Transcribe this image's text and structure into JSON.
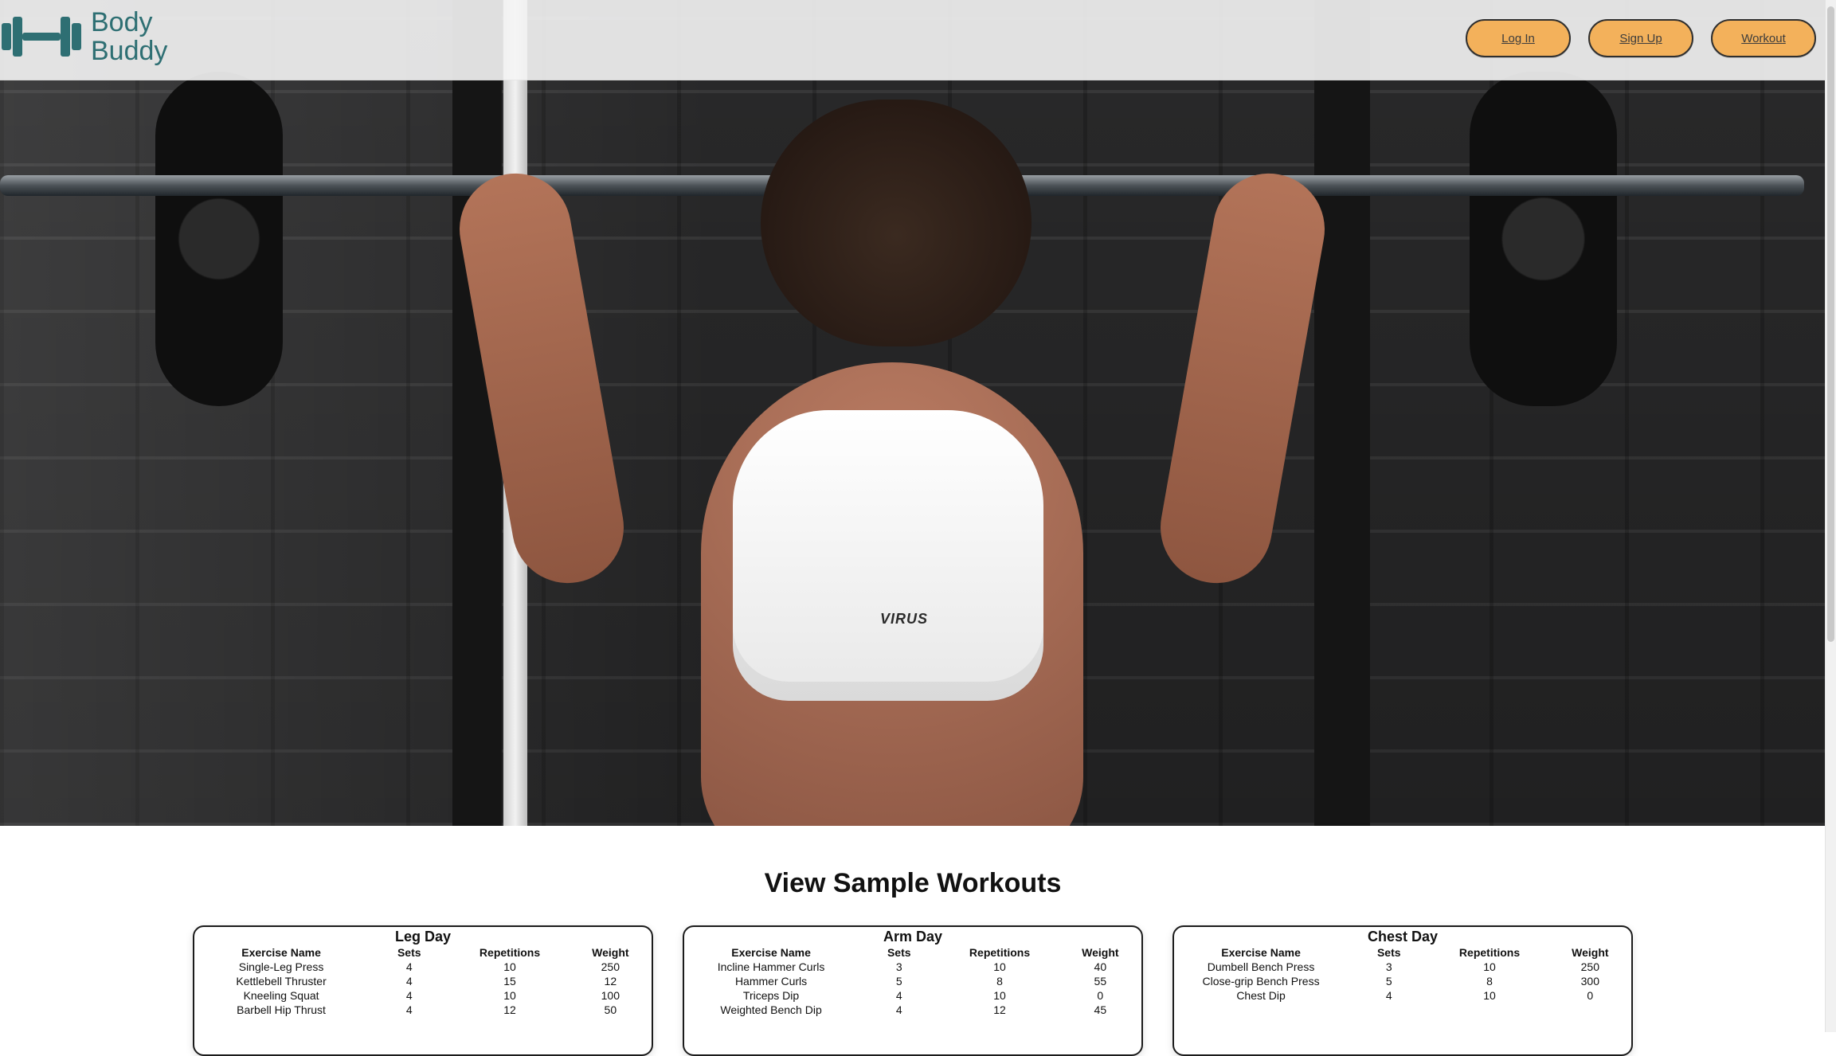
{
  "header": {
    "brand_line1": "Body",
    "brand_line2": "Buddy",
    "nav": {
      "login": "Log In",
      "signup": "Sign Up",
      "workout": "Workout"
    }
  },
  "hero": {
    "shirt_brand": "VIRUS"
  },
  "sample_workouts": {
    "title": "View Sample Workouts",
    "columns": [
      "Exercise Name",
      "Sets",
      "Repetitions",
      "Weight"
    ],
    "cards": [
      {
        "title": "Leg Day",
        "rows": [
          {
            "name": "Single-Leg Press",
            "sets": "4",
            "reps": "10",
            "weight": "250"
          },
          {
            "name": "Kettlebell Thruster",
            "sets": "4",
            "reps": "15",
            "weight": "12"
          },
          {
            "name": "Kneeling Squat",
            "sets": "4",
            "reps": "10",
            "weight": "100"
          },
          {
            "name": "Barbell Hip Thrust",
            "sets": "4",
            "reps": "12",
            "weight": "50"
          }
        ]
      },
      {
        "title": "Arm Day",
        "rows": [
          {
            "name": "Incline Hammer Curls",
            "sets": "3",
            "reps": "10",
            "weight": "40"
          },
          {
            "name": "Hammer Curls",
            "sets": "5",
            "reps": "8",
            "weight": "55"
          },
          {
            "name": "Triceps Dip",
            "sets": "4",
            "reps": "10",
            "weight": "0"
          },
          {
            "name": "Weighted Bench Dip",
            "sets": "4",
            "reps": "12",
            "weight": "45"
          }
        ]
      },
      {
        "title": "Chest Day",
        "rows": [
          {
            "name": "Dumbell Bench Press",
            "sets": "3",
            "reps": "10",
            "weight": "250"
          },
          {
            "name": "Close-grip Bench Press",
            "sets": "5",
            "reps": "8",
            "weight": "300"
          },
          {
            "name": "Chest Dip",
            "sets": "4",
            "reps": "10",
            "weight": "0"
          }
        ]
      }
    ]
  }
}
